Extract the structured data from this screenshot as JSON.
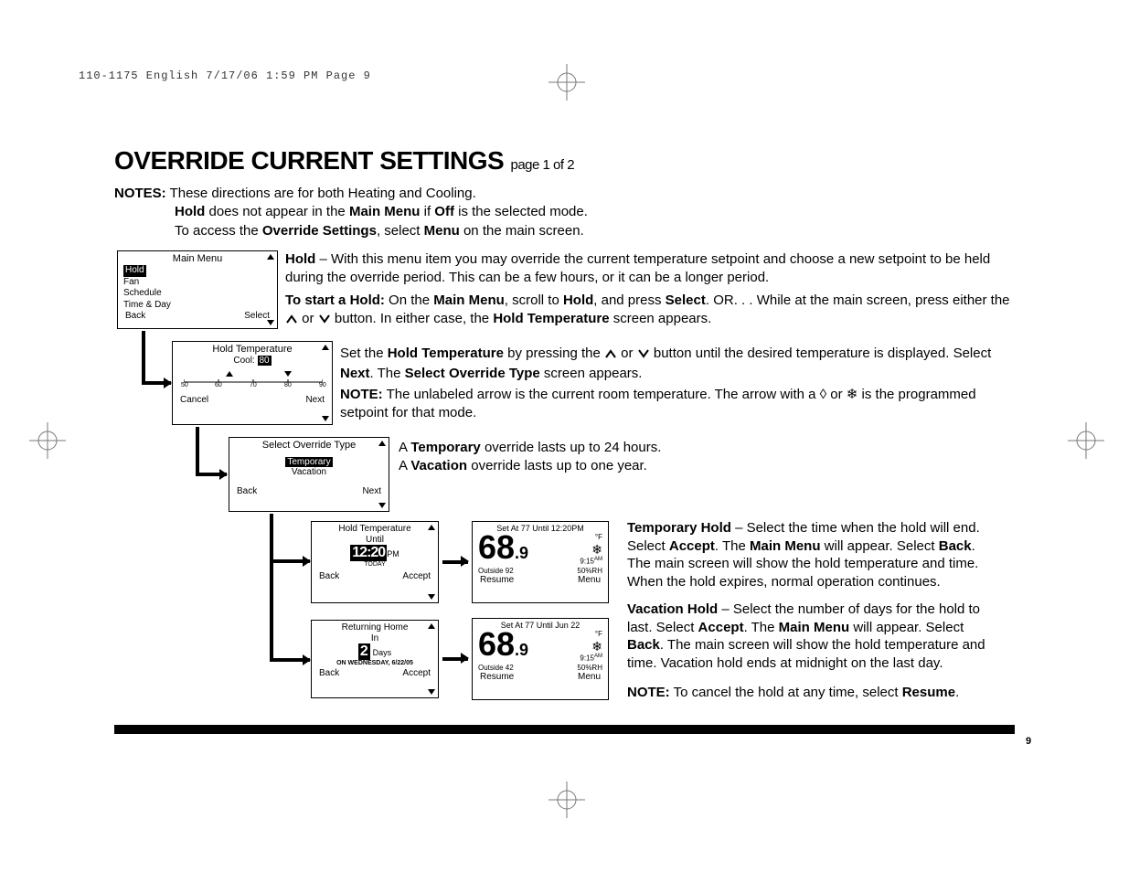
{
  "header": "110-1175 English  7/17/06  1:59 PM  Page 9",
  "page_number": "9",
  "title_main": "OVERRIDE CURRENT SETTINGS",
  "title_sub": "page 1 of 2",
  "notes_label": "NOTES:",
  "notes_line1": "These directions are for both Heating and Cooling.",
  "notes_line2a": "Hold",
  "notes_line2b": " does not appear in the ",
  "notes_line2c": "Main Menu",
  "notes_line2d": " if ",
  "notes_line2e": "Off",
  "notes_line2f": " is the selected mode.",
  "notes_line3a": "To access the ",
  "notes_line3b": "Override Settings",
  "notes_line3c": ", select ",
  "notes_line3d": "Menu",
  "notes_line3e": " on the main screen.",
  "scr_main": {
    "title": "Main Menu",
    "items": [
      "Hold",
      "Fan",
      "Schedule",
      "Time & Day"
    ],
    "back": "Back",
    "select": "Select"
  },
  "para_hold": {
    "lead": "Hold",
    "t1": " – With this menu item you may override the current temperature setpoint and choose a new setpoint to be held during the override period. This can be a few hours, or it can be a longer period.",
    "start_lead": "To start a Hold:",
    "t2a": " On the ",
    "t2b": "Main Menu",
    "t2c": ", scroll to ",
    "t2d": "Hold",
    "t2e": ", and press ",
    "t2f": "Select",
    "t2g": ".  OR. . . While at the main screen, press either the ",
    "t2h": " or ",
    "t2i": " button. In either case, the ",
    "t2j": "Hold Temperature",
    "t2k": " screen appears."
  },
  "scr_holdtemp": {
    "title": "Hold Temperature",
    "mode_label": "Cool:",
    "mode_val": "80",
    "scale": [
      "50",
      "60",
      "70",
      "80",
      "90"
    ],
    "cancel": "Cancel",
    "next": "Next"
  },
  "para_holdtemp": {
    "t1a": "Set the ",
    "t1b": "Hold Temperature",
    "t1c": " by pressing the ",
    "t1d": " or ",
    "t1e": " button until the desired temperature is displayed. Select ",
    "t1f": "Next",
    "t1g": ". The ",
    "t1h": "Select Override Type",
    "t1i": " screen appears.",
    "note_label": "NOTE:",
    "note_t1": " The unlabeled arrow is the current room temperature.  The arrow with a ",
    "note_t2": " or ",
    "note_t3": " is the programmed setpoint for that mode."
  },
  "scr_override": {
    "title": "Select Override Type",
    "opt1": "Temporary",
    "opt2": "Vacation",
    "back": "Back",
    "next": "Next"
  },
  "para_override": {
    "l1a": "A ",
    "l1b": "Temporary",
    "l1c": " override lasts up to 24 hours.",
    "l2a": "A ",
    "l2b": "Vacation",
    "l2c": " override lasts up to one year."
  },
  "scr_until": {
    "title": "Hold Temperature",
    "sub": "Until",
    "time": "12:20",
    "ampm": "PM",
    "today": "TODAY",
    "back": "Back",
    "accept": "Accept"
  },
  "scr_return": {
    "title": "Returning Home",
    "sub": "In",
    "days_val": "2",
    "days_label": "Days",
    "date": "ON WEDNESDAY, 6/22/05",
    "back": "Back",
    "accept": "Accept"
  },
  "scr_disp1": {
    "top": "Set At 77 Until 12:20PM",
    "temp_main": "68",
    "temp_dec": ".9",
    "unit": "°F",
    "time": "9:15",
    "time_sup": "AM",
    "outside": "Outside 92",
    "rh": "50%RH",
    "resume": "Resume",
    "menu": "Menu"
  },
  "scr_disp2": {
    "top": "Set At 77 Until Jun 22",
    "temp_main": "68",
    "temp_dec": ".9",
    "unit": "°F",
    "time": "9:15",
    "time_sup": "AM",
    "outside": "Outside 42",
    "rh": "50%RH",
    "resume": "Resume",
    "menu": "Menu"
  },
  "para_temp": {
    "lead": "Temporary Hold",
    "t1": " – Select the time when the hold will end. Select ",
    "b1": "Accept",
    "t2": ".  The ",
    "b2": "Main Menu",
    "t3": " will appear. Select ",
    "b3": "Back",
    "t4": ". The main screen will show the hold temperature and time. When the hold expires, normal operation continues."
  },
  "para_vac": {
    "lead": "Vacation Hold",
    "t1": " – Select the number of days for the hold to last.  Select ",
    "b1": "Accept",
    "t2": ".  The ",
    "b2": "Main Menu",
    "t3": " will appear. Select ",
    "b3": "Back",
    "t4": ".  The main screen will show the hold temperature and time.  Vacation hold ends at midnight on the last day."
  },
  "para_cancel": {
    "lead": "NOTE:",
    "t1": " To cancel the hold at any time, select ",
    "b1": "Resume",
    "t2": "."
  }
}
